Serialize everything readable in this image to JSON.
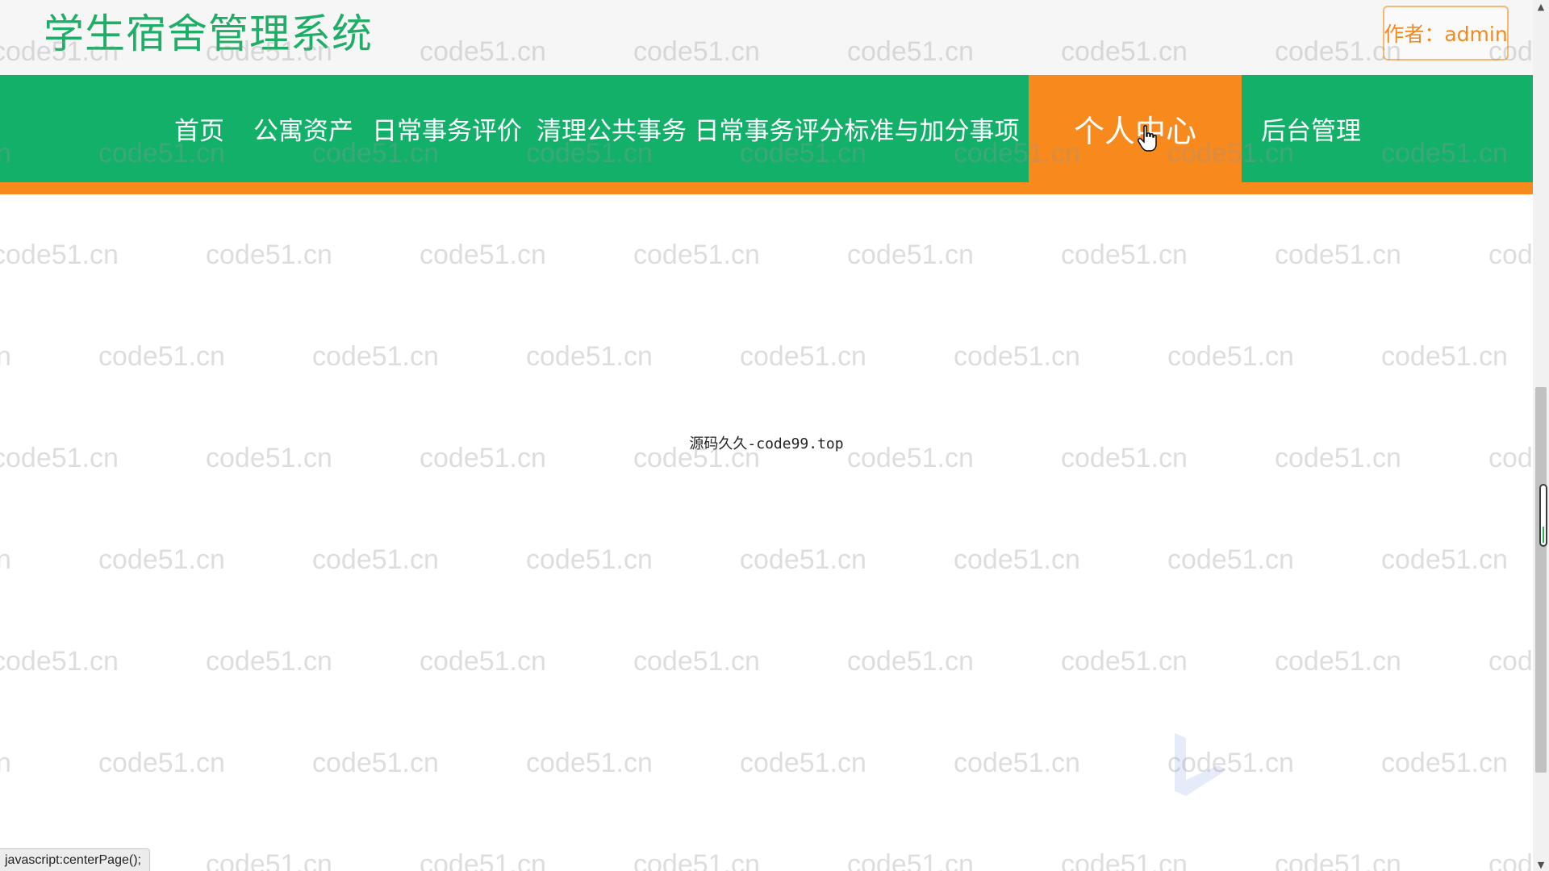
{
  "header": {
    "site_title": "学生宿舍管理系统",
    "author_badge": "作者：admin"
  },
  "nav": {
    "items": [
      {
        "label": "首页",
        "active": false
      },
      {
        "label": "公寓资产",
        "active": false
      },
      {
        "label": "日常事务评价",
        "active": false
      },
      {
        "label": "清理公共事务",
        "active": false
      },
      {
        "label": "日常事务评分标准与加分事项",
        "active": false
      },
      {
        "label": "个人中心",
        "active": true
      },
      {
        "label": "后台管理",
        "active": false
      }
    ]
  },
  "main": {
    "center_text": "源码久久-code99.top"
  },
  "watermark": {
    "text": "code51.cn"
  },
  "status_bar": {
    "text": "javascript:centerPage();"
  },
  "colors": {
    "brand_green": "#13b06a",
    "title_green": "#1fae67",
    "accent_orange": "#f7891d",
    "badge_text": "#f28a1f"
  },
  "icons": {
    "cursor": "hand-pointer-icon",
    "scroll_up": "arrow-up-icon",
    "scroll_down": "arrow-down-icon"
  }
}
